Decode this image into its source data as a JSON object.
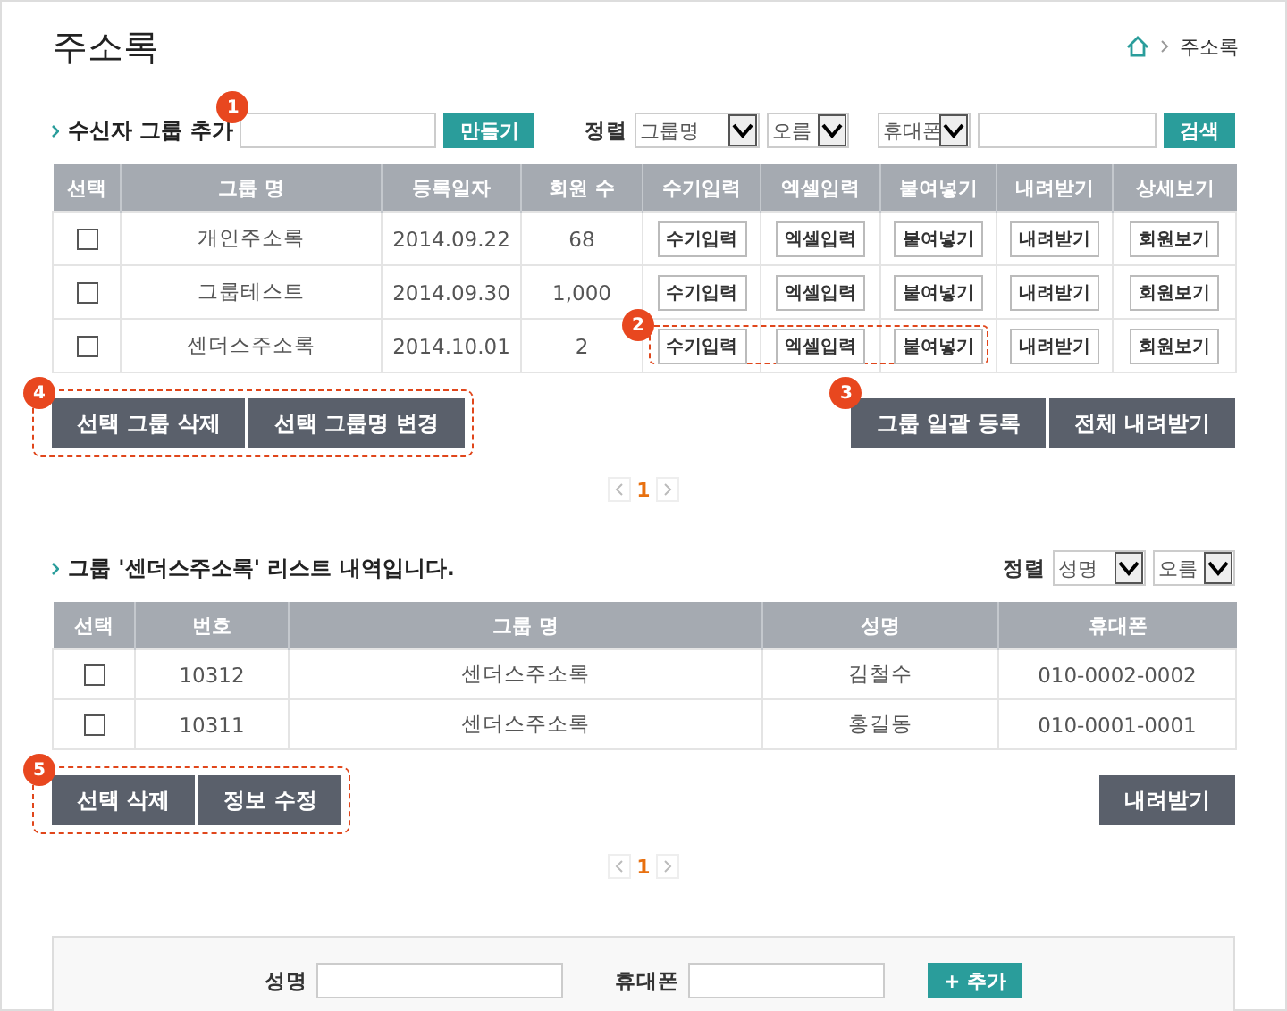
{
  "page": {
    "title": "주소록",
    "breadcrumb": "주소록"
  },
  "group_add": {
    "label": "수신자 그룹 추가",
    "marker": "1",
    "button": "만들기"
  },
  "sort": {
    "label": "정렬",
    "field": "그룹명",
    "order": "오름"
  },
  "search": {
    "field": "휴대폰",
    "button": "검색"
  },
  "group_table": {
    "columns": [
      "선택",
      "그룹 명",
      "등록일자",
      "회원 수",
      "수기입력",
      "엑셀입력",
      "붙여넣기",
      "내려받기",
      "상세보기"
    ],
    "rows": [
      {
        "checked": false,
        "name": "개인주소록",
        "date": "2014.09.22",
        "count": "68",
        "actions": [
          "수기입력",
          "엑셀입력",
          "붙여넣기",
          "내려받기",
          "회원보기"
        ]
      },
      {
        "checked": false,
        "name": "그룹테스트",
        "date": "2014.09.30",
        "count": "1,000",
        "actions": [
          "수기입력",
          "엑셀입력",
          "붙여넣기",
          "내려받기",
          "회원보기"
        ]
      },
      {
        "checked": false,
        "name": "센더스주소록",
        "date": "2014.10.01",
        "count": "2",
        "callout": "2",
        "actions": [
          "수기입력",
          "엑셀입력",
          "붙여넣기",
          "내려받기",
          "회원보기"
        ]
      }
    ]
  },
  "group_actions": {
    "left_marker": "4",
    "left": [
      "선택 그룹 삭제",
      "선택 그룹명 변경"
    ],
    "right_marker": "3",
    "right": [
      "그룹 일괄 등록",
      "전체 내려받기"
    ]
  },
  "group_pagination": {
    "pages": [
      {
        "label": "1",
        "selected": true
      }
    ]
  },
  "member_list": {
    "heading": "그룹 '센더스주소록' 리스트 내역입니다.",
    "sort_label": "정렬",
    "sort_field": "성명",
    "sort_order": "오름"
  },
  "member_table": {
    "columns": [
      "선택",
      "번호",
      "그룹 명",
      "성명",
      "휴대폰"
    ],
    "rows": [
      {
        "checked": false,
        "number": "10312",
        "group": "센더스주소록",
        "name": "김철수",
        "phone": "010-0002-0002"
      },
      {
        "checked": false,
        "number": "10311",
        "group": "센더스주소록",
        "name": "홍길동",
        "phone": "010-0001-0001"
      }
    ]
  },
  "member_actions": {
    "left_marker": "5",
    "left": [
      "선택 삭제",
      "정보 수정"
    ],
    "right": [
      "내려받기"
    ]
  },
  "member_pagination": {
    "pages": [
      {
        "label": "1",
        "selected": true
      }
    ]
  },
  "add_form": {
    "name_label": "성명",
    "phone_label": "휴대폰",
    "button": "+ 추가"
  }
}
